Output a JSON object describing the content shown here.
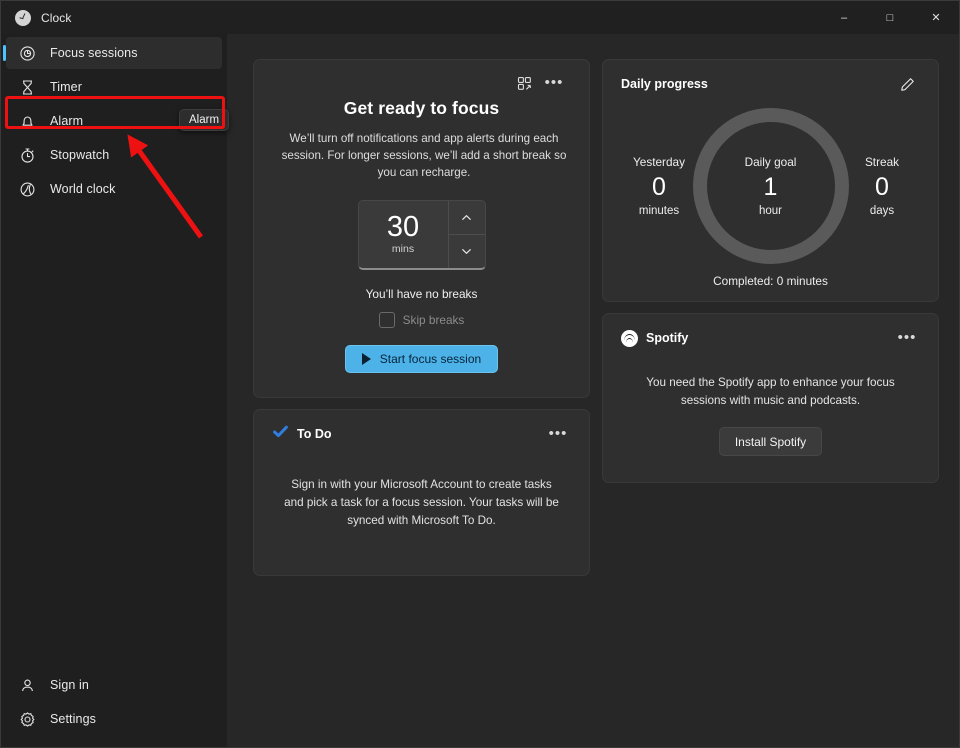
{
  "window": {
    "app_icon": "clock-icon",
    "title": "Clock",
    "controls": {
      "minimize": "–",
      "maximize": "□",
      "close": "✕"
    }
  },
  "sidebar": {
    "items": [
      {
        "label": "Focus sessions",
        "icon": "focus-sessions-icon",
        "selected": true
      },
      {
        "label": "Timer",
        "icon": "timer-icon",
        "selected": false
      },
      {
        "label": "Alarm",
        "icon": "alarm-bell-icon",
        "selected": false
      },
      {
        "label": "Stopwatch",
        "icon": "stopwatch-icon",
        "selected": false
      },
      {
        "label": "World clock",
        "icon": "world-clock-icon",
        "selected": false
      }
    ],
    "bottom_items": [
      {
        "label": "Sign in",
        "icon": "person-icon"
      },
      {
        "label": "Settings",
        "icon": "gear-icon"
      }
    ],
    "tooltip": "Alarm"
  },
  "focus_card": {
    "mini_view_icon": "mini-view-icon",
    "more_icon": "more-options-icon",
    "title": "Get ready to focus",
    "description": "We’ll turn off notifications and app alerts during each session. For longer sessions, we’ll add a short break so you can recharge.",
    "duration_value": "30",
    "duration_unit": "mins",
    "increase_icon": "chevron-up-icon",
    "decrease_icon": "chevron-down-icon",
    "breaks_text": "You’ll have no breaks",
    "skip_breaks_label": "Skip breaks",
    "skip_breaks_checked": false,
    "start_button": "Start focus session",
    "start_button_color": "#4cb2e8",
    "play_icon": "play-icon"
  },
  "todo_card": {
    "icon": "todo-check-icon",
    "icon_color": "#2f7ee0",
    "title": "To Do",
    "more_icon": "more-options-icon",
    "body": "Sign in with your Microsoft Account to create tasks and pick a task for a focus session. Your tasks will be synced with Microsoft To Do."
  },
  "progress_card": {
    "title": "Daily progress",
    "edit_icon": "pencil-icon",
    "ring_color": "#5a5a5a",
    "yesterday": {
      "label": "Yesterday",
      "value": "0",
      "unit": "minutes"
    },
    "daily_goal": {
      "label": "Daily goal",
      "value": "1",
      "unit": "hour"
    },
    "streak": {
      "label": "Streak",
      "value": "0",
      "unit": "days"
    },
    "completed": "Completed: 0 minutes"
  },
  "spotify_card": {
    "logo_icon": "spotify-logo-icon",
    "title": "Spotify",
    "more_icon": "more-options-icon",
    "body": "You need the Spotify app to enhance your focus sessions with music and podcasts.",
    "install_button": "Install Spotify"
  },
  "annotations": {
    "highlight_color": "#ee1111",
    "highlight_target": "Alarm",
    "arrow_target": "Alarm"
  }
}
